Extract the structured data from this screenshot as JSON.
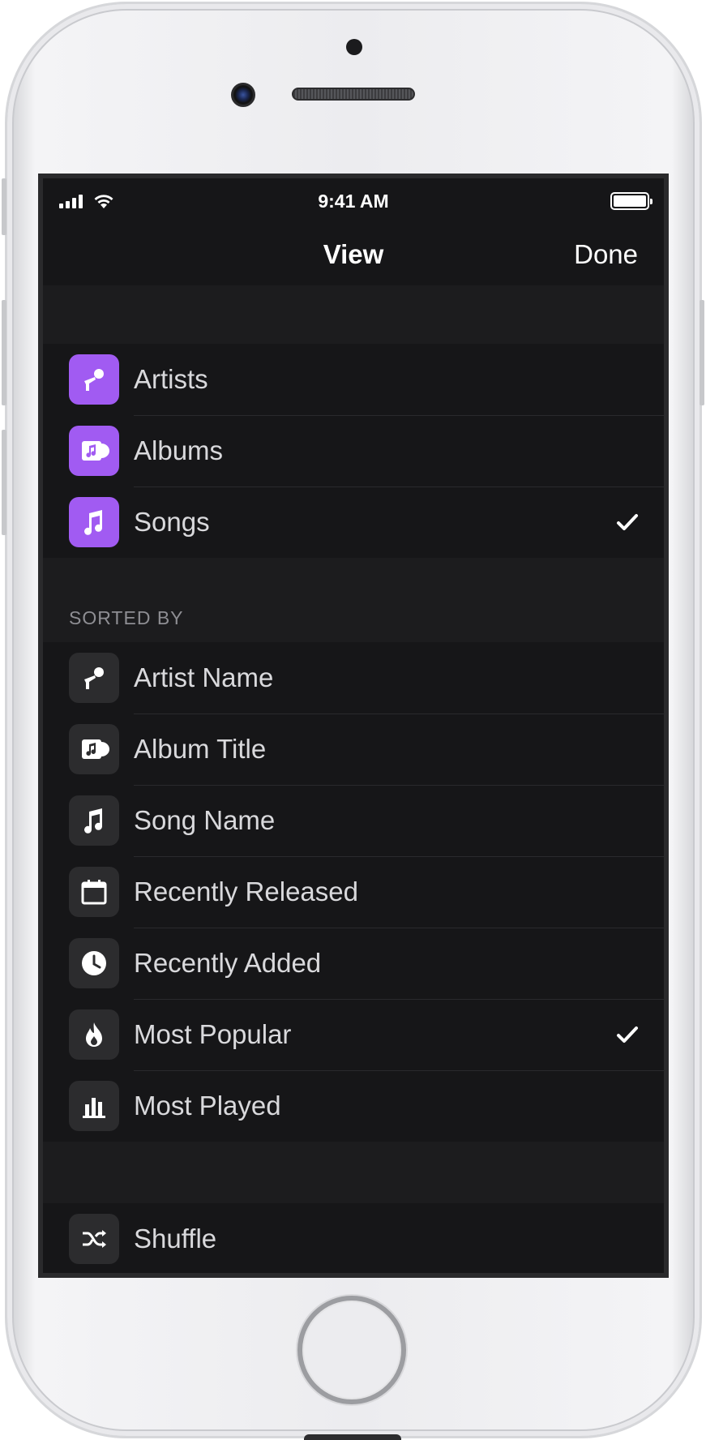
{
  "status_bar": {
    "time": "9:41 AM"
  },
  "nav": {
    "title": "View",
    "done_label": "Done"
  },
  "view_options": [
    {
      "label": "Artists",
      "icon": "microphone-icon",
      "selected": false
    },
    {
      "label": "Albums",
      "icon": "album-icon",
      "selected": false
    },
    {
      "label": "Songs",
      "icon": "music-note-icon",
      "selected": true
    }
  ],
  "sorted_by": {
    "header": "SORTED BY",
    "options": [
      {
        "label": "Artist Name",
        "icon": "microphone-icon",
        "selected": false
      },
      {
        "label": "Album Title",
        "icon": "album-icon",
        "selected": false
      },
      {
        "label": "Song Name",
        "icon": "music-note-icon",
        "selected": false
      },
      {
        "label": "Recently Released",
        "icon": "calendar-icon",
        "selected": false
      },
      {
        "label": "Recently Added",
        "icon": "clock-icon",
        "selected": false
      },
      {
        "label": "Most Popular",
        "icon": "flame-icon",
        "selected": true
      },
      {
        "label": "Most Played",
        "icon": "bar-chart-icon",
        "selected": false
      }
    ]
  },
  "actions": [
    {
      "label": "Shuffle",
      "icon": "shuffle-icon"
    }
  ],
  "colors": {
    "accent": "#a15bf2",
    "background": "#161618",
    "section_gap": "#1c1c1e",
    "icon_gray": "#2c2c2e"
  }
}
